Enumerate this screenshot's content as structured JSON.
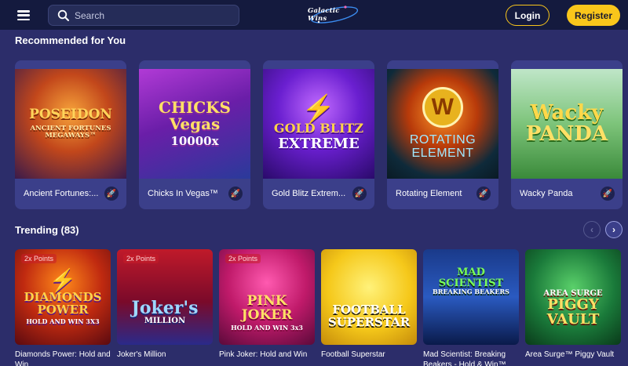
{
  "header": {
    "search_placeholder": "Search",
    "logo_text": "Galactic Wins",
    "login_label": "Login",
    "register_label": "Register"
  },
  "recommended": {
    "title": "Recommended for You",
    "items": [
      {
        "name": "Ancient Fortunes:...",
        "art_title": "POSEIDON",
        "art_sub": "ANCIENT FORTUNES MEGAWAYS™"
      },
      {
        "name": "Chicks In Vegas™",
        "art_title": "CHICKS Vegas",
        "art_sub": "10000x"
      },
      {
        "name": "Gold Blitz Extrem...",
        "art_title": "GOLD BLITZ",
        "art_sub": "EXTREME"
      },
      {
        "name": "Rotating Element",
        "art_title": "ROTATING",
        "art_sub": "ELEMENT"
      },
      {
        "name": "Wacky Panda",
        "art_title": "Wacky",
        "art_sub": "PANDA"
      }
    ]
  },
  "trending": {
    "title": "Trending (83)",
    "items": [
      {
        "name": "Diamonds Power: Hold and Win",
        "badge": "2x Points",
        "art_title": "DIAMONDS POWER",
        "art_sub": "HOLD AND WIN 3X3"
      },
      {
        "name": "Joker's Million",
        "badge": "2x Points",
        "art_title": "Joker's",
        "art_sub": "MILLION"
      },
      {
        "name": "Pink Joker: Hold and Win",
        "badge": "2x Points",
        "art_title": "PINK JOKER",
        "art_sub": "HOLD AND WIN 3x3"
      },
      {
        "name": "Football Superstar",
        "badge": "",
        "art_title": "FOOTBALL",
        "art_sub": "SUPERSTAR"
      },
      {
        "name": "Mad Scientist: Breaking Beakers - Hold & Win™",
        "badge": "",
        "art_title": "MAD SCIENTIST",
        "art_sub": "BREAKING BEAKERS"
      },
      {
        "name": "Area Surge™ Piggy Vault",
        "badge": "",
        "art_title": "AREA SURGE",
        "art_sub": "PIGGY VAULT"
      }
    ]
  },
  "icons": {
    "menu": "hamburger-icon",
    "search": "search-icon",
    "rocket": "rocket-icon",
    "prev": "chevron-left-icon",
    "next": "chevron-right-icon"
  },
  "colors": {
    "background": "#2c2d6a",
    "header": "#141a3e",
    "card": "#3b3f8a",
    "accent": "#f9c61b"
  }
}
